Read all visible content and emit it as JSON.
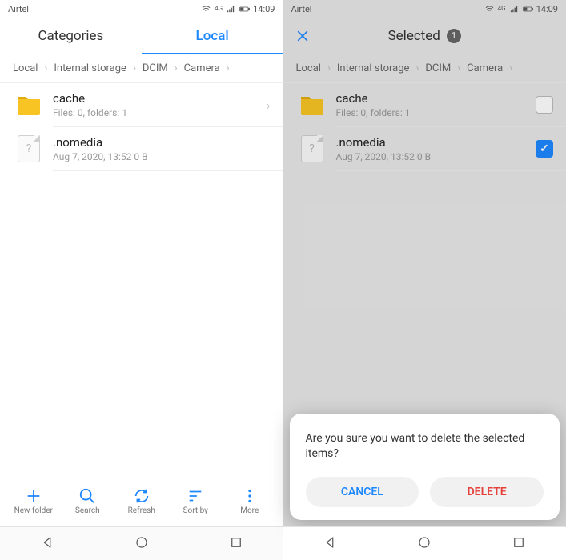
{
  "status": {
    "carrier": "Airtel",
    "time": "14:09"
  },
  "left": {
    "tabs": {
      "categories": "Categories",
      "local": "Local"
    },
    "breadcrumb": [
      "Local",
      "Internal storage",
      "DCIM",
      "Camera"
    ],
    "items": [
      {
        "name": "cache",
        "meta": "Files: 0, folders: 1"
      },
      {
        "name": ".nomedia",
        "meta": "Aug 7, 2020, 13:52 0 B"
      }
    ],
    "toolbar": {
      "newfolder": "New folder",
      "search": "Search",
      "refresh": "Refresh",
      "sortby": "Sort by",
      "more": "More"
    }
  },
  "right": {
    "header": {
      "title": "Selected",
      "count": "1"
    },
    "breadcrumb": [
      "Local",
      "Internal storage",
      "DCIM",
      "Camera"
    ],
    "items": [
      {
        "name": "cache",
        "meta": "Files: 0, folders: 1",
        "checked": false
      },
      {
        "name": ".nomedia",
        "meta": "Aug 7, 2020, 13:52 0 B",
        "checked": true
      }
    ],
    "dialog": {
      "message": "Are you sure you want to delete the selected items?",
      "cancel": "CANCEL",
      "delete": "DELETE"
    }
  }
}
